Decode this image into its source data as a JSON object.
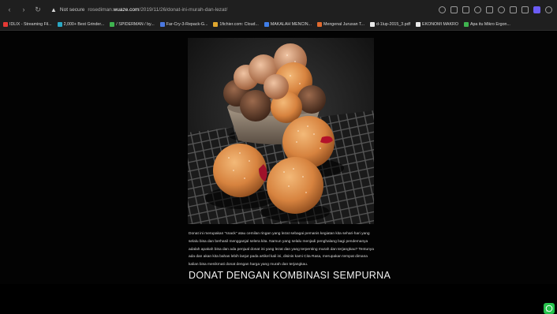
{
  "browser": {
    "security_label": "Not secure",
    "url_prefix": "rosediman.",
    "url_domain": "wuaze.com",
    "url_path": "/2019/11/26/donat-ini-murah-dan-lezat/"
  },
  "bookmarks": [
    {
      "label": "IDLIX - Streaming Fil...",
      "icon": "film-icon",
      "color": "#e53935"
    },
    {
      "label": "2,000+ Best Grinder...",
      "icon": "image-icon",
      "color": "#2aa8c4"
    },
    {
      "label": "/ SPIDERMAN / by...",
      "icon": "bookmark-icon",
      "color": "#3fb34f"
    },
    {
      "label": "Far-Cry-3-Repack-G...",
      "icon": "cloud-icon",
      "color": "#4a78e0"
    },
    {
      "label": "1fichier.com: Cloud...",
      "icon": "folder-icon",
      "color": "#e0a72f"
    },
    {
      "label": "MAKALAH MENCIN...",
      "icon": "globe-icon",
      "color": "#3f7ee8"
    },
    {
      "label": "Mengenal Jurusan T...",
      "icon": "circle-icon",
      "color": "#e06a2f"
    },
    {
      "label": "d-1lup-2015_3.pdf",
      "icon": "pdf-icon",
      "color": "#e9e9e9"
    },
    {
      "label": "EKONOMI MAKRO",
      "icon": "doc-icon",
      "color": "#e9e9e9"
    },
    {
      "label": "Apa itu Mikro Ergon...",
      "icon": "image-icon",
      "color": "#3fb34f"
    }
  ],
  "article": {
    "paragraph": "Donat ini merupakan \"snack\" atau cemilan ringan yang lezat sebagai pemanis kegiatan kita sehari-hari yang selalu bisa dan berhasil mengganjal selera kita. Namun yang selalu menjadi penghalang bagi pendemanya adalah apakah bisa dan ada penjual donat ini yang lezat dan yang terpenting murah dan terjangkau? Tentunya ada dan akan kita bahas lebih lanjut pada artikel kali ini, disinis kami Cita Rasa, merupakan tempat dimana kalian bisa menikmati donat dengan harga yang murah dan terjangkau.",
    "heading": "DONAT DENGAN KOMBINASI SEMPURNA"
  },
  "colors": {
    "page_bg": "#030303",
    "toolbar_bg": "#1f1f1f",
    "whatsapp": "#27c24c",
    "extension_accent": "#6c5cf5"
  }
}
